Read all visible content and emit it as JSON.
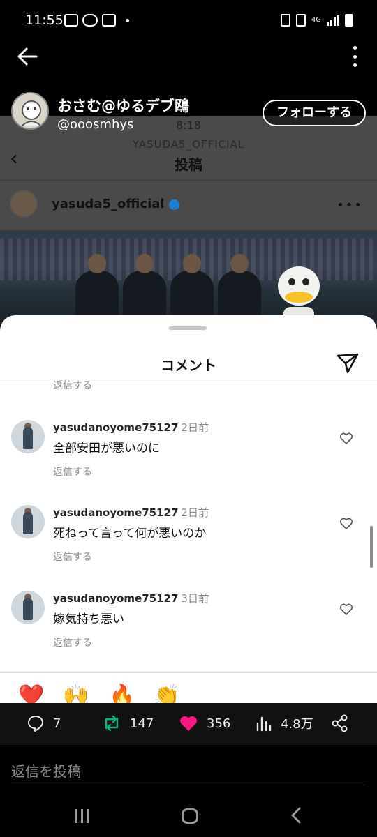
{
  "status_bar": {
    "time": "11:55",
    "network": "4G"
  },
  "post": {
    "display_name": "おさむ@ゆるデブ鴎",
    "handle": "@ooosmhys",
    "follow_label": "フォローする"
  },
  "embedded_screenshot": {
    "time": "8:18",
    "top_handle": "YASUDA5_OFFICIAL",
    "title": "投稿",
    "username": "yasuda5_official"
  },
  "comments_sheet": {
    "title": "コメント",
    "partial_reply_label": "返信する",
    "comments": [
      {
        "user": "yasudanoyome75127",
        "time": "2日前",
        "text": "全部安田が悪いのに",
        "reply_label": "返信する"
      },
      {
        "user": "yasudanoyome75127",
        "time": "2日前",
        "text": "死ねって言って何が悪いのか",
        "reply_label": "返信する"
      },
      {
        "user": "yasudanoyome75127",
        "time": "3日前",
        "text": "嫁気持ち悪い",
        "reply_label": "返信する"
      }
    ],
    "emoji_reactions": [
      "❤️",
      "🙌",
      "🔥",
      "👏",
      "😢",
      "😍",
      "😮",
      "😂"
    ]
  },
  "stats": {
    "replies": "7",
    "reposts": "147",
    "likes": "356",
    "views": "4.8万",
    "repost_color": "#00ba7c",
    "like_color": "#f91880"
  },
  "reply_box": {
    "placeholder": "返信を投稿"
  }
}
